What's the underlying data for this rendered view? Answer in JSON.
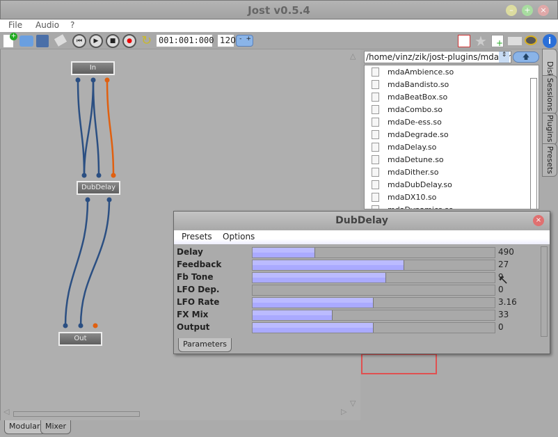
{
  "window": {
    "title": "Jost v0.5.4"
  },
  "menu": [
    "File",
    "Audio",
    "?"
  ],
  "toolbar": {
    "position": "001:001:000",
    "tempo": "120",
    "tempo_stepper": [
      "-",
      "+"
    ],
    "icons": [
      "new-plugin-icon",
      "print-icon",
      "save-icon",
      "plug-icon",
      "rewind-icon",
      "play-icon",
      "stop-icon",
      "record-icon",
      "loop-icon",
      "fullscreen-icon",
      "star-icon",
      "add-window-icon",
      "edit-icon",
      "speaker-icon",
      "info-icon"
    ]
  },
  "graph": {
    "nodes": [
      "In",
      "DubDelay",
      "Out"
    ]
  },
  "bottom_tabs": [
    "Modular",
    "Mixer"
  ],
  "browser": {
    "path": "/home/vinz/zik/jost-plugins/mda_linux",
    "files": [
      "mdaAmbience.so",
      "mdaBandisto.so",
      "mdaBeatBox.so",
      "mdaCombo.so",
      "mdaDe-ess.so",
      "mdaDegrade.so",
      "mdaDelay.so",
      "mdaDetune.so",
      "mdaDither.so",
      "mdaDubDelay.so",
      "mdaDX10.so",
      "mdaDynamics.so"
    ]
  },
  "side_tabs": [
    "Disk",
    "Sessions",
    "Plugins",
    "Presets"
  ],
  "plugin_window": {
    "title": "DubDelay",
    "menu": [
      "Presets",
      "Options"
    ],
    "tab": "Parameters",
    "params": [
      {
        "name": "Delay",
        "value": "490",
        "level": 0.26
      },
      {
        "name": "Feedback",
        "value": "27",
        "level": 0.625
      },
      {
        "name": "Fb Tone",
        "value": "9",
        "level": 0.553
      },
      {
        "name": "LFO Dep.",
        "value": "0",
        "level": 0
      },
      {
        "name": "LFO Rate",
        "value": "3.16",
        "level": 0.5
      },
      {
        "name": "FX Mix",
        "value": "33",
        "level": 0.33
      },
      {
        "name": "Output",
        "value": "0",
        "level": 0.5
      }
    ]
  },
  "colors": {
    "wire_blue": "#2b4f82",
    "wire_orange": "#e06010",
    "slider_fill": "#b8b8ff"
  }
}
